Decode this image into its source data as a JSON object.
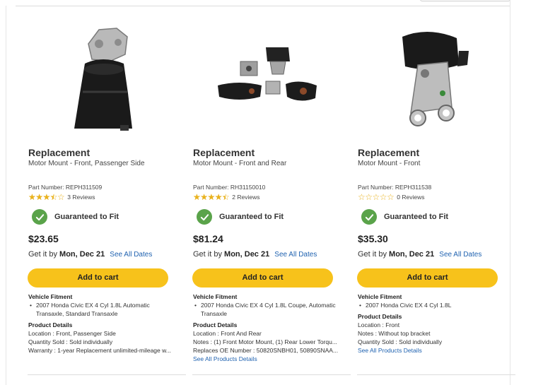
{
  "products": [
    {
      "brand": "Replacement",
      "subtitle": "Motor Mount - Front, Passenger Side",
      "part_number": "Part Number: REPH311509",
      "rating": 3.5,
      "reviews": "3 Reviews",
      "guarantee": "Guaranteed to Fit",
      "price": "$23.65",
      "delivery_prefix": "Get it by",
      "delivery_date": "Mon, Dec 21",
      "see_dates": "See All Dates",
      "cart_label": "Add to cart",
      "fitment_heading": "Vehicle Fitment",
      "fitment": [
        "2007 Honda Civic EX 4 Cyl 1.8L Automatic Transaxle, Standard Transaxle"
      ],
      "details_heading": "Product Details",
      "details": [
        "Location : Front, Passenger Side",
        "Quantity Sold : Sold individually",
        "Warranty : 1-year Replacement unlimited-mileage w..."
      ],
      "details_link": ""
    },
    {
      "brand": "Replacement",
      "subtitle": "Motor Mount - Front and Rear",
      "part_number": "Part Number: RH31150010",
      "rating": 4.5,
      "reviews": "2 Reviews",
      "guarantee": "Guaranteed to Fit",
      "price": "$81.24",
      "delivery_prefix": "Get it by",
      "delivery_date": "Mon, Dec 21",
      "see_dates": "See All Dates",
      "cart_label": "Add to cart",
      "fitment_heading": "Vehicle Fitment",
      "fitment": [
        "2007 Honda Civic EX 4 Cyl 1.8L Coupe, Automatic Transaxle"
      ],
      "details_heading": "Product Details",
      "details": [
        "Location : Front And Rear",
        "Notes : (1) Front Motor Mount, (1) Rear Lower Torqu...",
        "Replaces OE Number : 50820SNBH01, 50890SNAA..."
      ],
      "details_link": "See All Products Details"
    },
    {
      "brand": "Replacement",
      "subtitle": "Motor Mount - Front",
      "part_number": "Part Number: REPH311538",
      "rating": 0,
      "reviews": "0 Reviews",
      "guarantee": "Guaranteed to Fit",
      "price": "$35.30",
      "delivery_prefix": "Get it by",
      "delivery_date": "Mon, Dec 21",
      "see_dates": "See All Dates",
      "cart_label": "Add to cart",
      "fitment_heading": "Vehicle Fitment",
      "fitment": [
        "2007 Honda Civic EX 4 Cyl 1.8L"
      ],
      "details_heading": "Product Details",
      "details": [
        "Location : Front",
        "Notes : Without top bracket",
        "Quantity Sold : Sold individually"
      ],
      "details_link": "See All Products Details"
    }
  ],
  "colors": {
    "accent_yellow": "#f7c21b",
    "check_green": "#5aa34a",
    "link_blue": "#1f62b0",
    "star_gold": "#e9b21d"
  }
}
